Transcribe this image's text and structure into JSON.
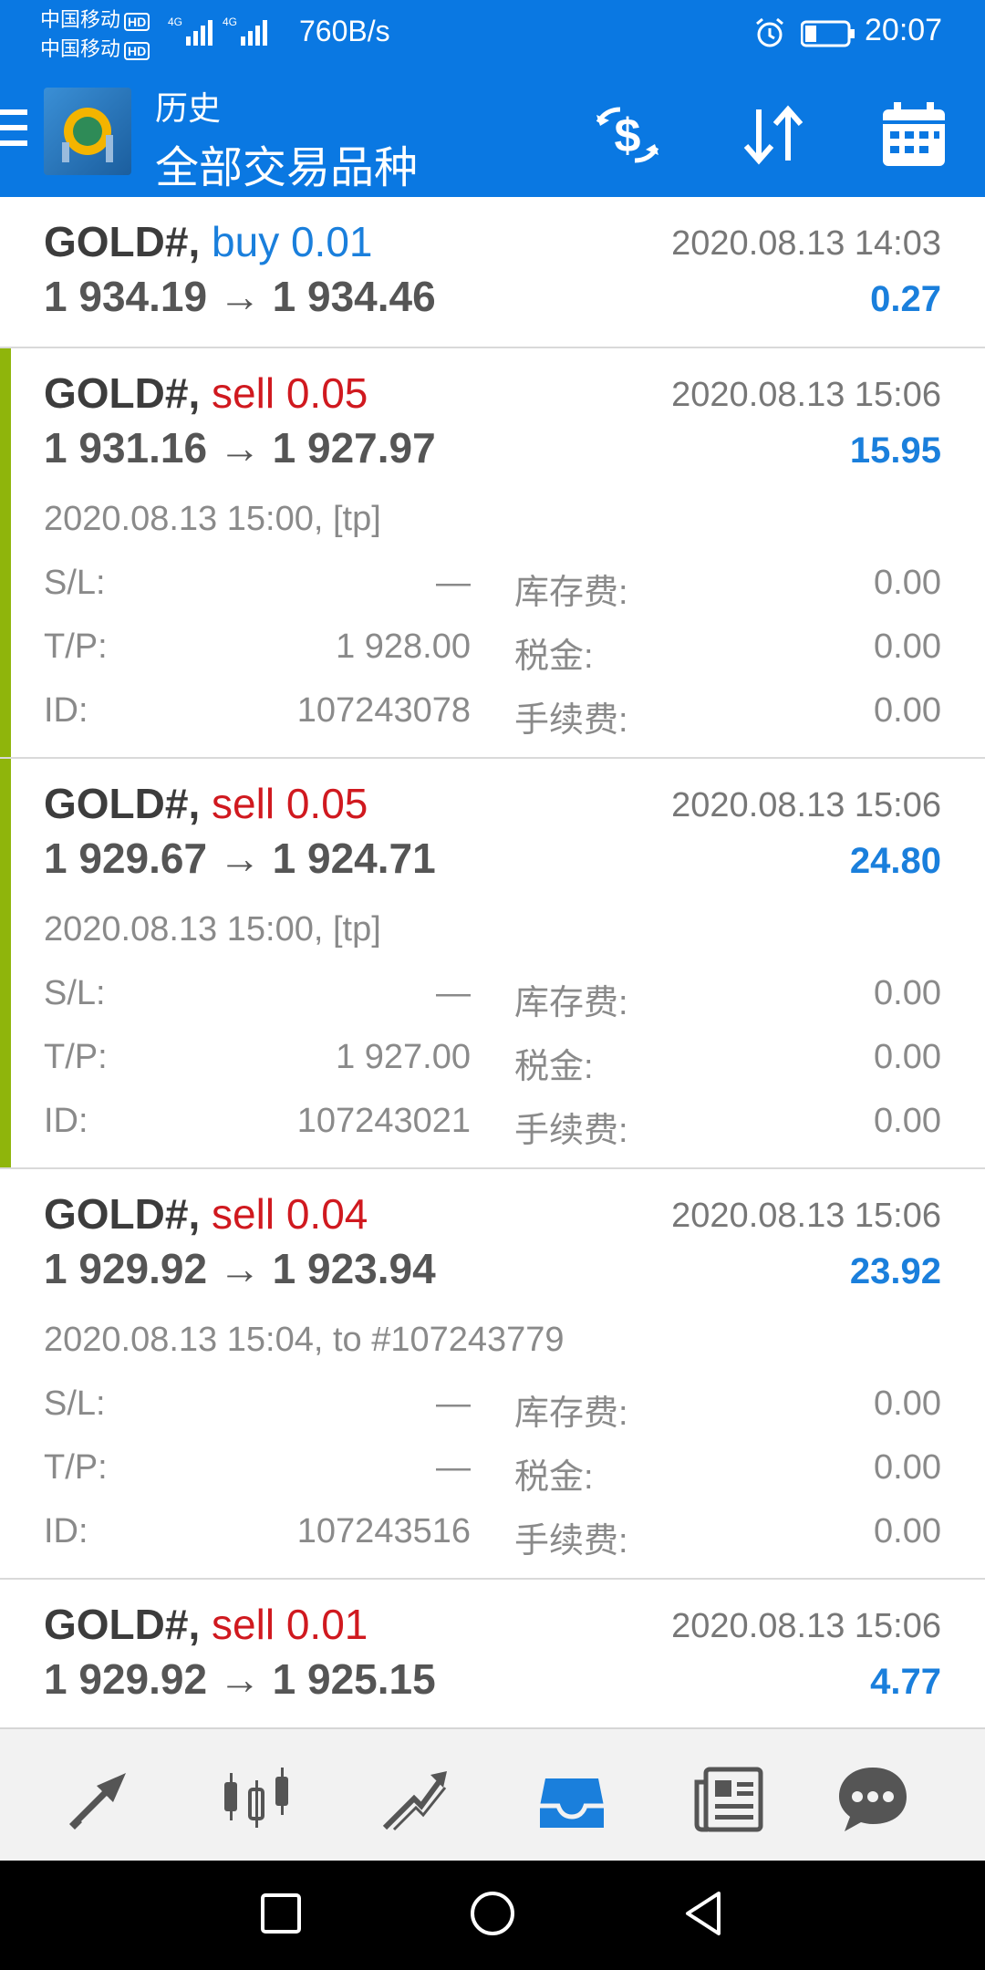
{
  "status_bar": {
    "carrier1": "中国移动",
    "carrier2": "中国移动",
    "hd": "HD",
    "network": "4G",
    "net_speed": "760B/s",
    "time": "20:07",
    "icons": [
      "signal-icon",
      "alarm-icon",
      "battery-icon"
    ]
  },
  "header": {
    "subtitle": "历史",
    "title": "全部交易品种",
    "actions": [
      "currency-exchange-icon",
      "sort-icon",
      "calendar-icon"
    ]
  },
  "labels": {
    "sl": "S/L:",
    "tp": "T/P:",
    "id": "ID:",
    "swap": "库存费:",
    "tax": "税金:",
    "fee": "手续费:"
  },
  "trades": [
    {
      "symbol": "GOLD#,",
      "side": "buy 0.01",
      "time": "2020.08.13 14:03",
      "prices": "1 934.19 → 1 934.46",
      "profit": "0.27"
    },
    {
      "symbol": "GOLD#,",
      "side": "sell 0.05",
      "time": "2020.08.13 15:06",
      "prices": "1 931.16 → 1 927.97",
      "profit": "15.95",
      "comment": "2020.08.13 15:00, [tp]",
      "sl": "—",
      "tp": "1 928.00",
      "id": "107243078",
      "swap": "0.00",
      "tax": "0.00",
      "fee": "0.00"
    },
    {
      "symbol": "GOLD#,",
      "side": "sell 0.05",
      "time": "2020.08.13 15:06",
      "prices": "1 929.67 → 1 924.71",
      "profit": "24.80",
      "comment": "2020.08.13 15:00, [tp]",
      "sl": "—",
      "tp": "1 927.00",
      "id": "107243021",
      "swap": "0.00",
      "tax": "0.00",
      "fee": "0.00"
    },
    {
      "symbol": "GOLD#,",
      "side": "sell 0.04",
      "time": "2020.08.13 15:06",
      "prices": "1 929.92 → 1 923.94",
      "profit": "23.92",
      "comment": "2020.08.13 15:04, to #107243779",
      "sl": "—",
      "tp": "—",
      "id": "107243516",
      "swap": "0.00",
      "tax": "0.00",
      "fee": "0.00"
    },
    {
      "symbol": "GOLD#,",
      "side": "sell 0.01",
      "time": "2020.08.13 15:06",
      "prices": "1 929.92 → 1 925.15",
      "profit": "4.77"
    }
  ],
  "bottom_nav": [
    "quotes-icon",
    "chart-icon",
    "trade-icon",
    "history-icon",
    "news-icon",
    "chat-icon"
  ],
  "bottom_nav_active": "history-icon",
  "system_nav": [
    "recents-icon",
    "home-icon",
    "back-icon"
  ],
  "colors": {
    "primary": "#0a78e2",
    "buy": "#1a7fdc",
    "sell": "#d0191f",
    "profit": "#1a7fdc",
    "accent_bar": "#8fb50b"
  }
}
